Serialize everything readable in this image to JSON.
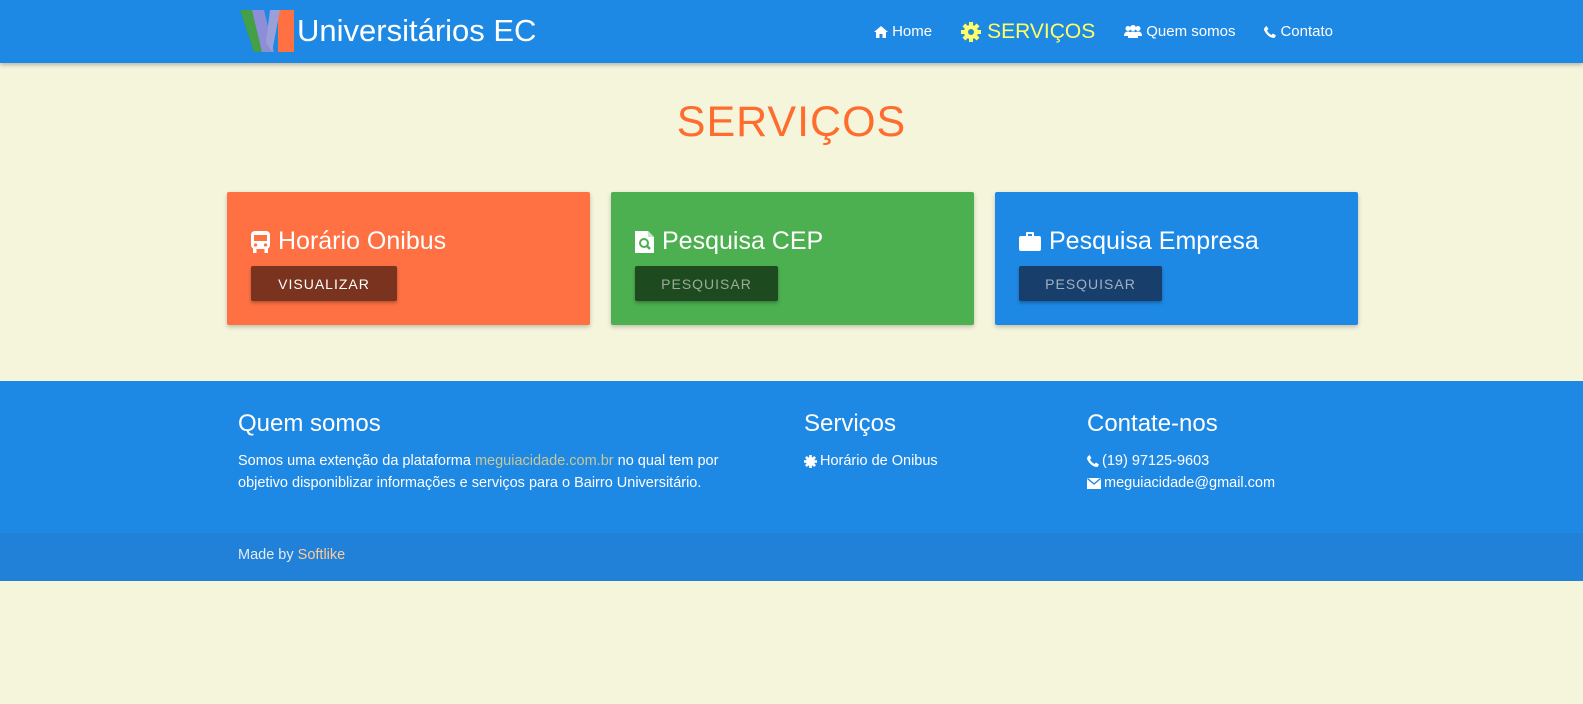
{
  "navbar": {
    "brand": "Universitários EC",
    "items": [
      {
        "label": "Home",
        "icon": "home-icon"
      },
      {
        "label": "SERVIÇOS",
        "icon": "gear-icon",
        "active": true
      },
      {
        "label": "Quem somos",
        "icon": "users-icon"
      },
      {
        "label": "Contato",
        "icon": "phone-icon"
      }
    ]
  },
  "page": {
    "title": "SERVIÇOS"
  },
  "cards": [
    {
      "title": "Horário Onibus",
      "button": "VISUALIZAR",
      "icon": "bus-icon",
      "color": "#ff7043"
    },
    {
      "title": "Pesquisa CEP",
      "button": "PESQUISAR",
      "icon": "file-search-icon",
      "color": "#4caf50"
    },
    {
      "title": "Pesquisa Empresa",
      "button": "PESQUISAR",
      "icon": "briefcase-icon",
      "color": "#1e88e5"
    }
  ],
  "footer": {
    "about": {
      "title": "Quem somos",
      "text_before": "Somos uma extenção da plataforma ",
      "link": "meguiacidade.com.br",
      "text_after": " no qual tem por objetivo disponiblizar informações e serviços para o Bairro Universitário."
    },
    "services": {
      "title": "Serviços",
      "items": [
        {
          "label": "Horário de Onibus",
          "icon": "gear-icon"
        }
      ]
    },
    "contact": {
      "title": "Contate-nos",
      "phone": "(19) 97125-9603",
      "email": "meguiacidade@gmail.com"
    },
    "made_by_prefix": "Made by ",
    "made_by_link": "Softlike"
  },
  "colors": {
    "background": "#f5f5dc",
    "primary": "#1e88e5",
    "accent": "#ff6d2e",
    "active_nav": "#ffff66"
  }
}
